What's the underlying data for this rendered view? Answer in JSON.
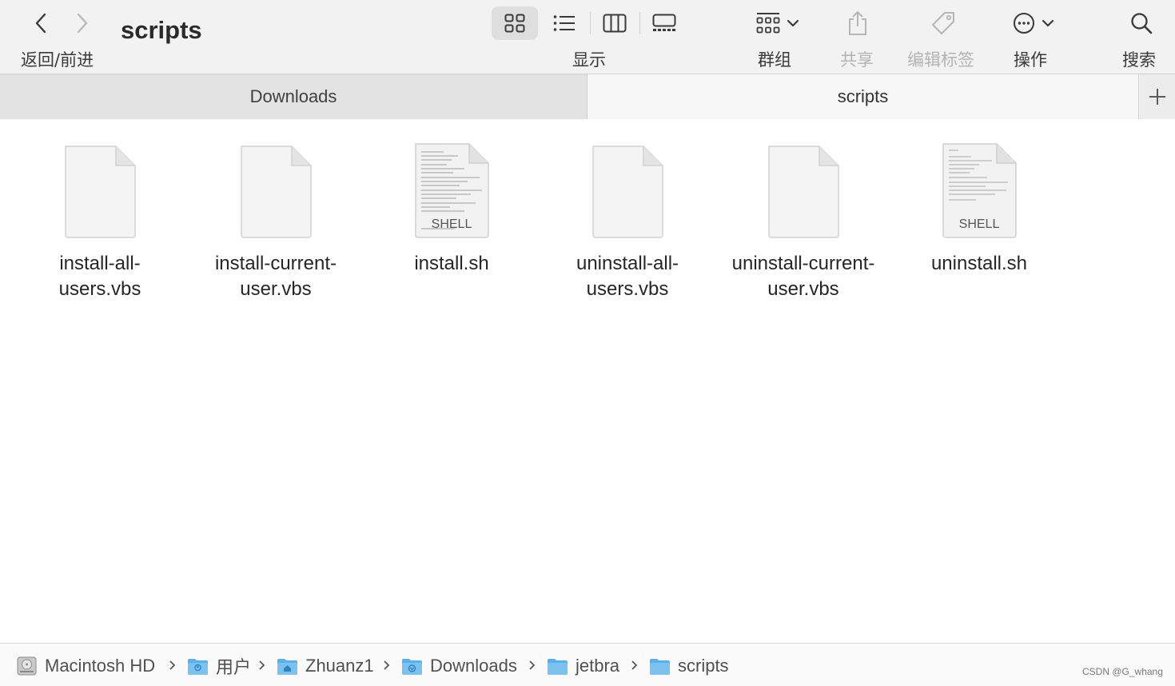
{
  "toolbar": {
    "window_title": "scripts",
    "nav_caption": "返回/前进",
    "view_caption": "显示",
    "group_caption": "群组",
    "share_caption": "共享",
    "tags_caption": "编辑标签",
    "action_caption": "操作",
    "search_caption": "搜索",
    "active_view": "icon-view",
    "icons": [
      "chevron-left-icon",
      "chevron-right-icon",
      "grid-view-icon",
      "list-view-icon",
      "column-view-icon",
      "gallery-view-icon",
      "group-icon",
      "share-icon",
      "tag-icon",
      "more-icon",
      "search-icon"
    ]
  },
  "tabs": [
    {
      "label": "Downloads",
      "active": false
    },
    {
      "label": "scripts",
      "active": true
    }
  ],
  "files": [
    {
      "line1": "install-all-",
      "line2": "users.vbs",
      "kind": "blank"
    },
    {
      "line1": "install-current-",
      "line2": "user.vbs",
      "kind": "blank"
    },
    {
      "line1": "install.sh",
      "line2": "",
      "kind": "shell",
      "badge": "SHELL"
    },
    {
      "line1": "uninstall-all-",
      "line2": "users.vbs",
      "kind": "blank"
    },
    {
      "line1": "uninstall-current-",
      "line2": "user.vbs",
      "kind": "blank"
    },
    {
      "line1": "uninstall.sh",
      "line2": "",
      "kind": "shell",
      "badge": "SHELL"
    }
  ],
  "path": [
    {
      "label": "Macintosh HD",
      "icon": "hard-drive-icon"
    },
    {
      "label": "用户",
      "icon": "users-folder-icon"
    },
    {
      "label": "Zhuanz1",
      "icon": "home-folder-icon"
    },
    {
      "label": "Downloads",
      "icon": "downloads-folder-icon"
    },
    {
      "label": "jetbra",
      "icon": "folder-icon"
    },
    {
      "label": "scripts",
      "icon": "folder-icon"
    }
  ],
  "watermark": "CSDN @G_whang",
  "colors": {
    "folder_blue": "#5ab0ea",
    "toolbar_bg": "#f2f2f2",
    "active_tab": "#f7f7f7",
    "inactive_tab": "#e3e3e3"
  }
}
